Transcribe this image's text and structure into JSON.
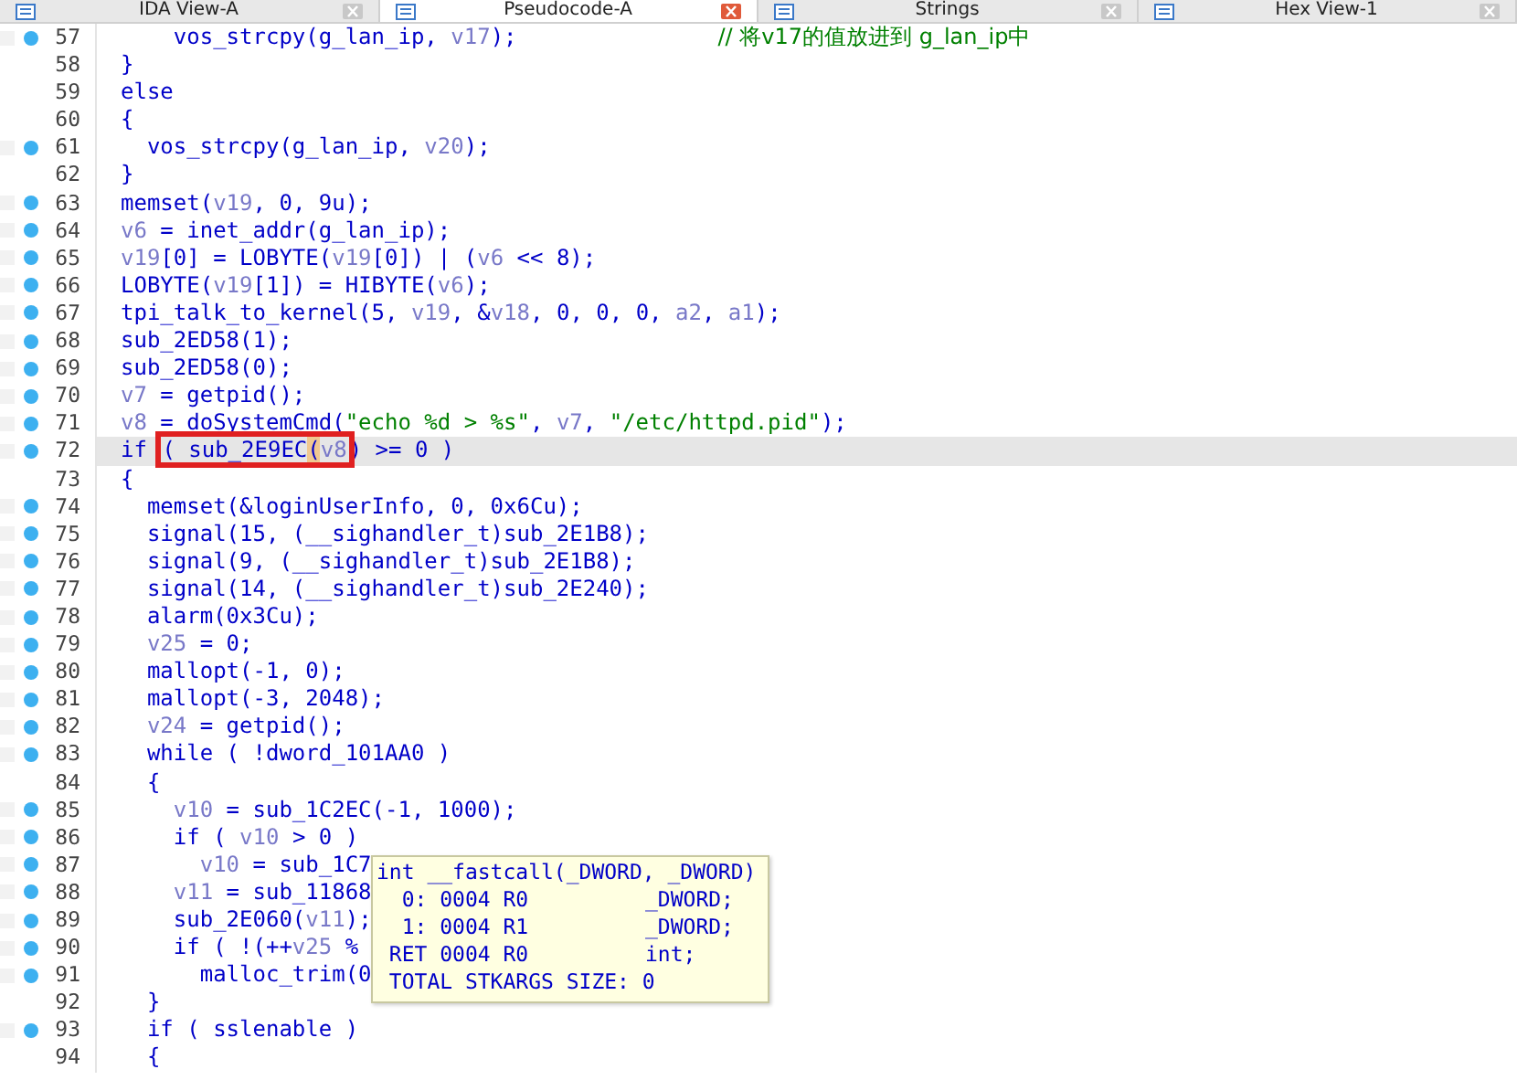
{
  "tabs": [
    {
      "label": "IDA View-A",
      "selected": false
    },
    {
      "label": "Pseudocode-A",
      "selected": true
    },
    {
      "label": "Strings",
      "selected": false
    },
    {
      "label": "Hex View-1",
      "selected": false
    }
  ],
  "code": {
    "lines": [
      {
        "number": "57",
        "breakpoint": true,
        "current": false,
        "segments": [
          {
            "kind": "code",
            "text": "    vos_strcpy(g_lan_ip, "
          },
          {
            "kind": "var",
            "text": "v17"
          },
          {
            "kind": "code",
            "text": ");"
          },
          {
            "kind": "comment",
            "text": "// 将v17的值放进到 g_lan_ip中"
          }
        ]
      },
      {
        "number": "58",
        "breakpoint": false,
        "current": false,
        "segments": [
          {
            "kind": "code",
            "text": "}"
          }
        ]
      },
      {
        "number": "59",
        "breakpoint": false,
        "current": false,
        "segments": [
          {
            "kind": "code",
            "text": "else"
          }
        ]
      },
      {
        "number": "60",
        "breakpoint": false,
        "current": false,
        "segments": [
          {
            "kind": "code",
            "text": "{"
          }
        ]
      },
      {
        "number": "61",
        "breakpoint": true,
        "current": false,
        "segments": [
          {
            "kind": "code",
            "text": "  vos_strcpy(g_lan_ip, "
          },
          {
            "kind": "var",
            "text": "v20"
          },
          {
            "kind": "code",
            "text": ");"
          }
        ]
      },
      {
        "number": "62",
        "breakpoint": false,
        "current": false,
        "segments": [
          {
            "kind": "code",
            "text": "}"
          }
        ]
      },
      {
        "number": "63",
        "breakpoint": true,
        "current": false,
        "segments": [
          {
            "kind": "code",
            "text": "memset("
          },
          {
            "kind": "var",
            "text": "v19"
          },
          {
            "kind": "code",
            "text": ", 0, 9u);"
          }
        ]
      },
      {
        "number": "64",
        "breakpoint": true,
        "current": false,
        "segments": [
          {
            "kind": "var",
            "text": "v6"
          },
          {
            "kind": "code",
            "text": " = inet_addr(g_lan_ip);"
          }
        ]
      },
      {
        "number": "65",
        "breakpoint": true,
        "current": false,
        "segments": [
          {
            "kind": "var",
            "text": "v19"
          },
          {
            "kind": "code",
            "text": "[0] = LOBYTE("
          },
          {
            "kind": "var",
            "text": "v19"
          },
          {
            "kind": "code",
            "text": "[0]) | ("
          },
          {
            "kind": "var",
            "text": "v6"
          },
          {
            "kind": "code",
            "text": " << 8);"
          }
        ]
      },
      {
        "number": "66",
        "breakpoint": true,
        "current": false,
        "segments": [
          {
            "kind": "code",
            "text": "LOBYTE("
          },
          {
            "kind": "var",
            "text": "v19"
          },
          {
            "kind": "code",
            "text": "[1]) = HIBYTE("
          },
          {
            "kind": "var",
            "text": "v6"
          },
          {
            "kind": "code",
            "text": ");"
          }
        ]
      },
      {
        "number": "67",
        "breakpoint": true,
        "current": false,
        "segments": [
          {
            "kind": "code",
            "text": "tpi_talk_to_kernel(5, "
          },
          {
            "kind": "var",
            "text": "v19"
          },
          {
            "kind": "code",
            "text": ", &"
          },
          {
            "kind": "var",
            "text": "v18"
          },
          {
            "kind": "code",
            "text": ", 0, 0, 0, "
          },
          {
            "kind": "var",
            "text": "a2"
          },
          {
            "kind": "code",
            "text": ", "
          },
          {
            "kind": "var",
            "text": "a1"
          },
          {
            "kind": "code",
            "text": ");"
          }
        ]
      },
      {
        "number": "68",
        "breakpoint": true,
        "current": false,
        "segments": [
          {
            "kind": "code",
            "text": "sub_2ED58(1);"
          }
        ]
      },
      {
        "number": "69",
        "breakpoint": true,
        "current": false,
        "segments": [
          {
            "kind": "code",
            "text": "sub_2ED58(0);"
          }
        ]
      },
      {
        "number": "70",
        "breakpoint": true,
        "current": false,
        "segments": [
          {
            "kind": "var",
            "text": "v7"
          },
          {
            "kind": "code",
            "text": " = getpid();"
          }
        ]
      },
      {
        "number": "71",
        "breakpoint": true,
        "current": false,
        "segments": [
          {
            "kind": "var",
            "text": "v8"
          },
          {
            "kind": "code",
            "text": " = doSystemCmd("
          },
          {
            "kind": "string",
            "text": "\"echo %d > %s\""
          },
          {
            "kind": "code",
            "text": ", "
          },
          {
            "kind": "var",
            "text": "v7"
          },
          {
            "kind": "code",
            "text": ", "
          },
          {
            "kind": "string",
            "text": "\"/etc/httpd.pid\""
          },
          {
            "kind": "code",
            "text": ");"
          }
        ]
      },
      {
        "number": "72",
        "breakpoint": true,
        "current": true,
        "segments": [
          {
            "kind": "code",
            "text": "if "
          },
          {
            "kind": "code",
            "text": "( sub_2E9EC",
            "boxed": true
          },
          {
            "kind": "code",
            "text": "(",
            "boxed": true,
            "matched": true
          },
          {
            "kind": "var",
            "text": "v8",
            "boxed": true
          },
          {
            "kind": "code",
            "text": ") >= 0 )",
            "matched": false
          }
        ]
      },
      {
        "number": "73",
        "breakpoint": false,
        "current": false,
        "segments": [
          {
            "kind": "code",
            "text": "{"
          }
        ]
      },
      {
        "number": "74",
        "breakpoint": true,
        "current": false,
        "segments": [
          {
            "kind": "code",
            "text": "  memset(&loginUserInfo, 0, 0x6Cu);"
          }
        ]
      },
      {
        "number": "75",
        "breakpoint": true,
        "current": false,
        "segments": [
          {
            "kind": "code",
            "text": "  signal(15, (__sighandler_t)sub_2E1B8);"
          }
        ]
      },
      {
        "number": "76",
        "breakpoint": true,
        "current": false,
        "segments": [
          {
            "kind": "code",
            "text": "  signal(9, (__sighandler_t)sub_2E1B8);"
          }
        ]
      },
      {
        "number": "77",
        "breakpoint": true,
        "current": false,
        "segments": [
          {
            "kind": "code",
            "text": "  signal(14, (__sighandler_t)sub_2E240);"
          }
        ]
      },
      {
        "number": "78",
        "breakpoint": true,
        "current": false,
        "segments": [
          {
            "kind": "code",
            "text": "  alarm(0x3Cu);"
          }
        ]
      },
      {
        "number": "79",
        "breakpoint": true,
        "current": false,
        "segments": [
          {
            "kind": "var",
            "text": "  v25"
          },
          {
            "kind": "code",
            "text": " = 0;"
          }
        ]
      },
      {
        "number": "80",
        "breakpoint": true,
        "current": false,
        "segments": [
          {
            "kind": "code",
            "text": "  mallopt(-1, 0);"
          }
        ]
      },
      {
        "number": "81",
        "breakpoint": true,
        "current": false,
        "segments": [
          {
            "kind": "code",
            "text": "  mallopt(-3, 2048);"
          }
        ]
      },
      {
        "number": "82",
        "breakpoint": true,
        "current": false,
        "segments": [
          {
            "kind": "var",
            "text": "  v24"
          },
          {
            "kind": "code",
            "text": " = getpid();"
          }
        ]
      },
      {
        "number": "83",
        "breakpoint": true,
        "current": false,
        "segments": [
          {
            "kind": "code",
            "text": "  while ( !dword_101AA0 )"
          }
        ]
      },
      {
        "number": "84",
        "breakpoint": false,
        "current": false,
        "segments": [
          {
            "kind": "code",
            "text": "  {"
          }
        ]
      },
      {
        "number": "85",
        "breakpoint": true,
        "current": false,
        "segments": [
          {
            "kind": "var",
            "text": "    v10"
          },
          {
            "kind": "code",
            "text": " = sub_1C2EC(-1, 1000);"
          }
        ]
      },
      {
        "number": "86",
        "breakpoint": true,
        "current": false,
        "segments": [
          {
            "kind": "code",
            "text": "    if ( "
          },
          {
            "kind": "var",
            "text": "v10"
          },
          {
            "kind": "code",
            "text": " > 0 )"
          }
        ]
      },
      {
        "number": "87",
        "breakpoint": true,
        "current": false,
        "segments": [
          {
            "kind": "var",
            "text": "      v10"
          },
          {
            "kind": "code",
            "text": " = sub_1C7"
          }
        ]
      },
      {
        "number": "88",
        "breakpoint": true,
        "current": false,
        "segments": [
          {
            "kind": "var",
            "text": "    v11"
          },
          {
            "kind": "code",
            "text": " = sub_11868"
          }
        ]
      },
      {
        "number": "89",
        "breakpoint": true,
        "current": false,
        "segments": [
          {
            "kind": "code",
            "text": "    sub_2E060("
          },
          {
            "kind": "var",
            "text": "v11"
          },
          {
            "kind": "code",
            "text": ");"
          }
        ]
      },
      {
        "number": "90",
        "breakpoint": true,
        "current": false,
        "segments": [
          {
            "kind": "code",
            "text": "    if ( !(++"
          },
          {
            "kind": "var",
            "text": "v25"
          },
          {
            "kind": "code",
            "text": " %"
          }
        ]
      },
      {
        "number": "91",
        "breakpoint": true,
        "current": false,
        "segments": [
          {
            "kind": "code",
            "text": "      malloc_trim(0"
          }
        ]
      },
      {
        "number": "92",
        "breakpoint": false,
        "current": false,
        "segments": [
          {
            "kind": "code",
            "text": "  }"
          }
        ]
      },
      {
        "number": "93",
        "breakpoint": true,
        "current": false,
        "segments": [
          {
            "kind": "code",
            "text": "  if ( sslenable )"
          }
        ]
      },
      {
        "number": "94",
        "breakpoint": false,
        "current": false,
        "segments": [
          {
            "kind": "code",
            "text": "  {"
          }
        ]
      }
    ]
  },
  "tooltip": {
    "lines": [
      {
        "text": "int __fastcall(_DWORD, _DWORD)"
      },
      {
        "text": "  0: 0004 R0",
        "type": "_DWORD;"
      },
      {
        "text": "  1: 0004 R1",
        "type": "_DWORD;"
      },
      {
        "text": " RET 0004 R0",
        "type": "int;"
      },
      {
        "text": " TOTAL STKARGS SIZE: 0"
      }
    ]
  }
}
